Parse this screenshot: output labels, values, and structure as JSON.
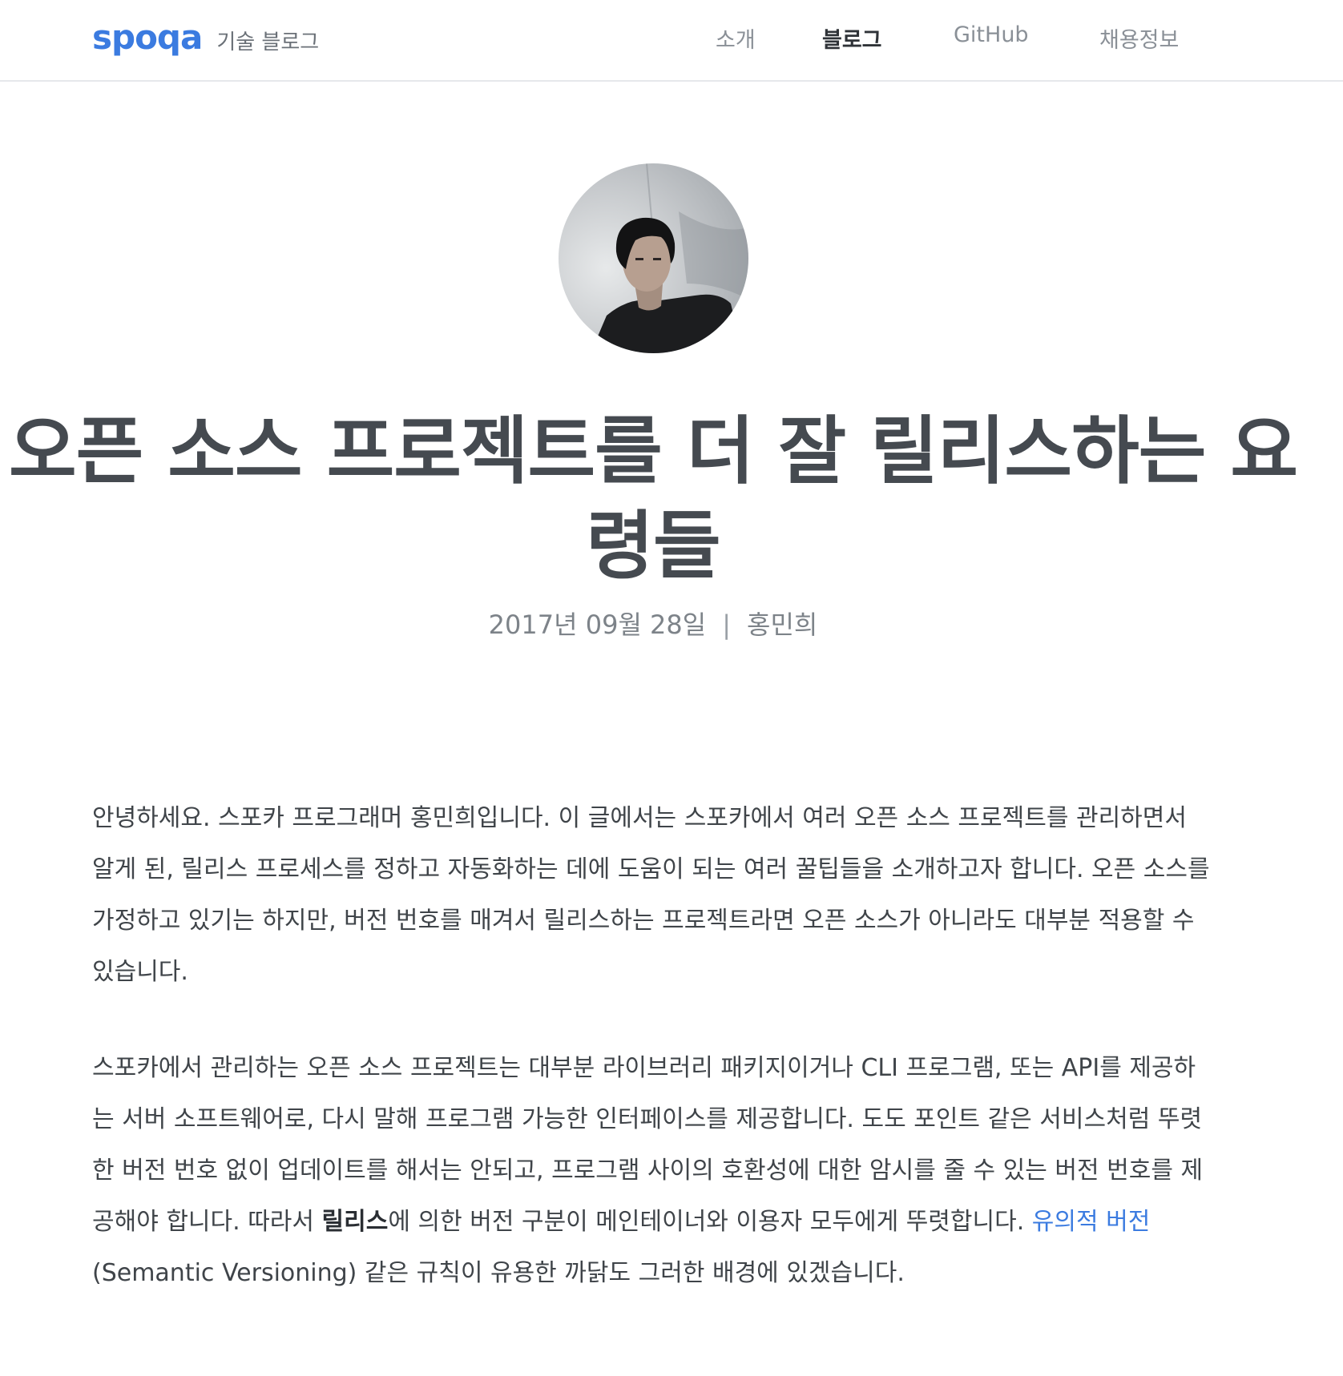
{
  "header": {
    "logo": "spoqa",
    "subtitle": "기술 블로그",
    "nav": [
      {
        "label": "소개",
        "active": false
      },
      {
        "label": "블로그",
        "active": true
      },
      {
        "label": "GitHub",
        "active": false
      },
      {
        "label": "채용정보",
        "active": false
      }
    ]
  },
  "post": {
    "title": "오픈 소스 프로젝트를 더 잘 릴리스하는 요령들",
    "date": "2017년 09월 28일",
    "separator": "|",
    "author": "홍민희",
    "paragraph1": "안녕하세요. 스포카 프로그래머 홍민희입니다. 이 글에서는 스포카에서 여러 오픈 소스 프로젝트를 관리하면서 알게 된, 릴리스 프로세스를 정하고 자동화하는 데에 도움이 되는 여러 꿀팁들을 소개하고자 합니다. 오픈 소스를 가정하고 있기는 하지만, 버전 번호를 매겨서 릴리스하는 프로젝트라면 오픈 소스가 아니라도 대부분 적용할 수 있습니다.",
    "paragraph2": {
      "part1": "스포카에서 관리하는 오픈 소스 프로젝트는 대부분 라이브러리 패키지이거나 CLI 프로그램, 또는 API를 제공하는 서버 소프트웨어로, 다시 말해 프로그램 가능한 인터페이스를 제공합니다. 도도 포인트 같은 서비스처럼 뚜렷한 버전 번호 없이 업데이트를 해서는 안되고, 프로그램 사이의 호환성에 대한 암시를 줄 수 있는 버전 번호를 제공해야 합니다. 따라서 ",
      "bold": "릴리스",
      "part2": "에 의한 버전 구분이 메인테이너와 이용자 모두에게 뚜렷합니다. ",
      "link": "유의적 버전",
      "part3": "(Semantic Versioning) 같은 규칙이 유용한 까닭도 그러한 배경에 있겠습니다."
    }
  },
  "colors": {
    "brand": "#3b7be0",
    "link": "#3b7be0",
    "text": "#454a50"
  }
}
